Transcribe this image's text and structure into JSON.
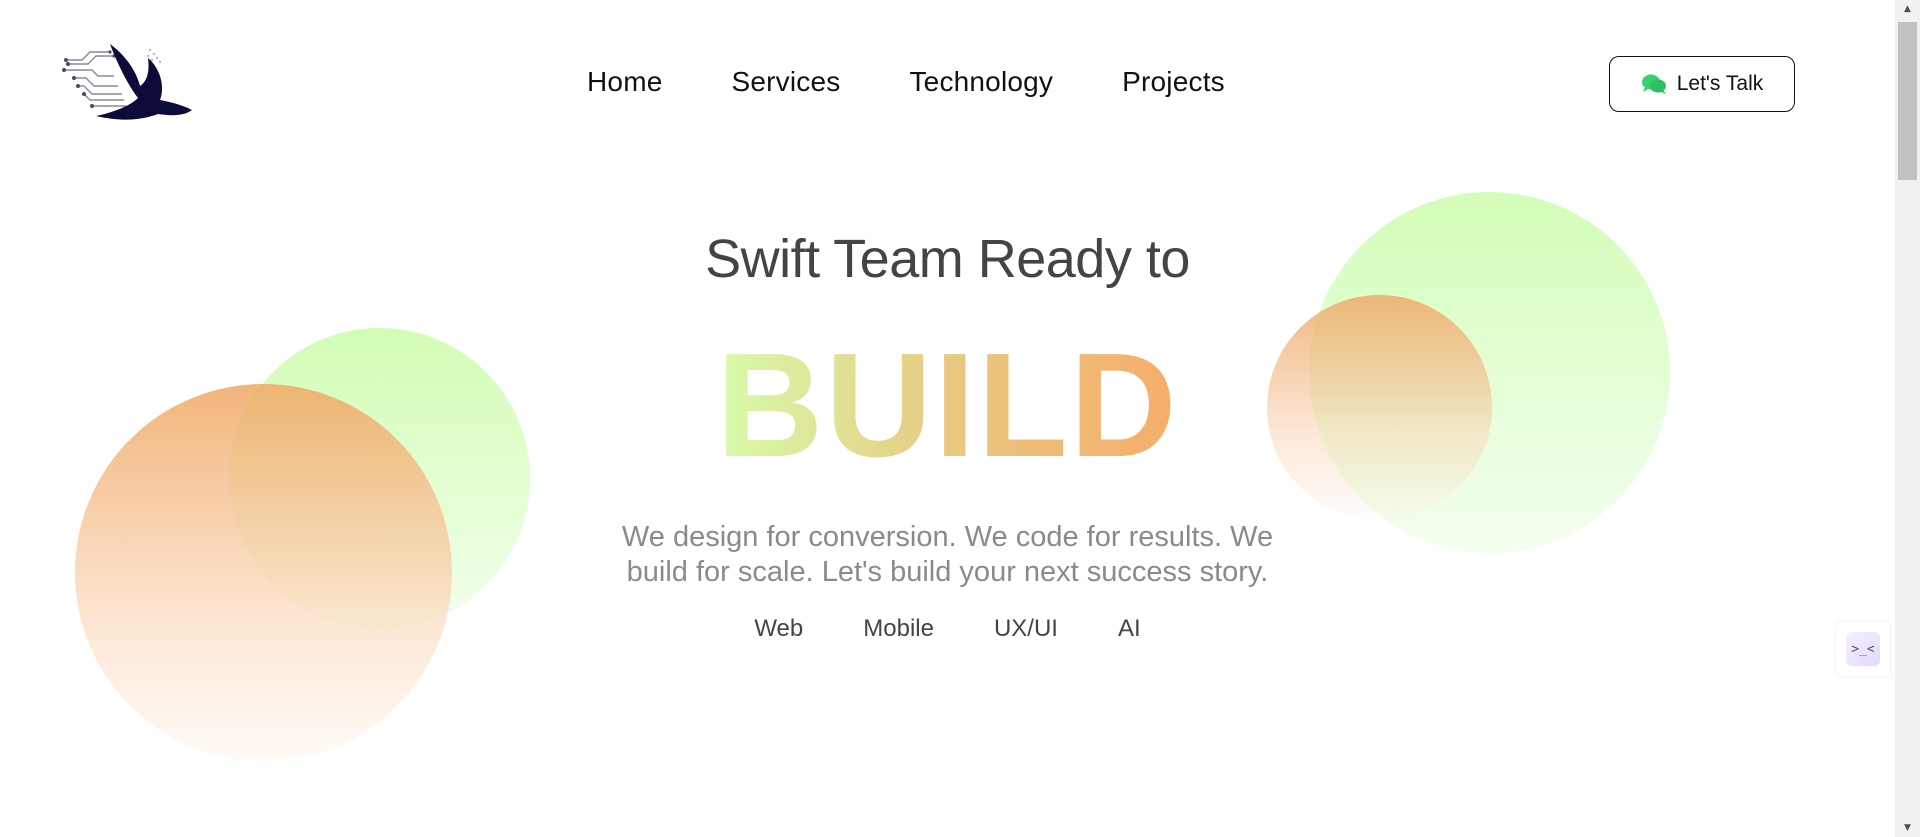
{
  "header": {
    "nav": [
      "Home",
      "Services",
      "Technology",
      "Projects"
    ],
    "cta_label": "Let's Talk"
  },
  "hero": {
    "title": "Swift Team Ready to",
    "highlight": "BUILD",
    "subtitle": "We design for conversion. We code for results. We build for scale. Let's build your next success story.",
    "tags": [
      "Web",
      "Mobile",
      "UX/UI",
      "AI"
    ]
  },
  "side_widget": {
    "glyph": ">_<"
  },
  "colors": {
    "green_circle": "#d2fdb6",
    "orange_circle": "#f0a864",
    "chat_icon": "#34d26a",
    "logo": "#0d0b3a",
    "highlight_gradient": [
      "#d6fcab",
      "#e9c981",
      "#f6ac6a"
    ]
  }
}
